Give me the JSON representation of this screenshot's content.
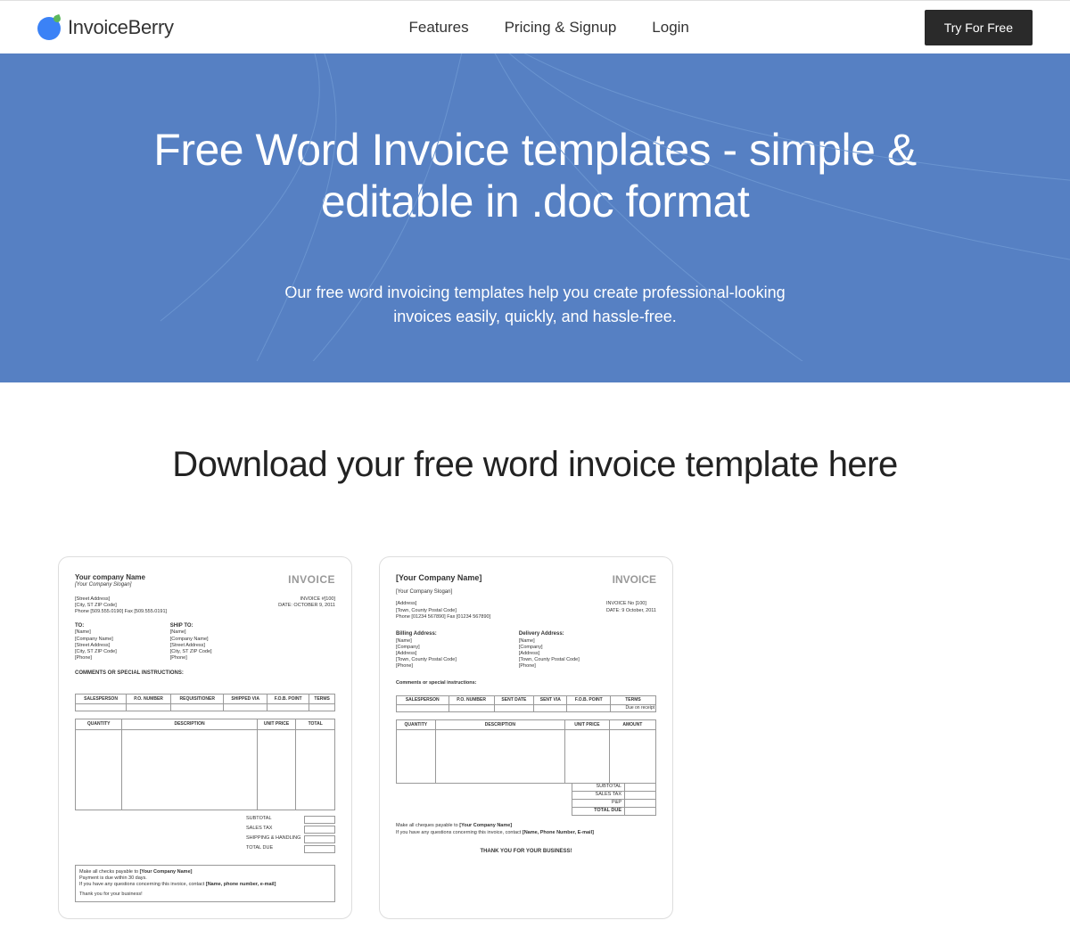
{
  "header": {
    "brand": "InvoiceBerry",
    "nav": [
      {
        "label": "Features"
      },
      {
        "label": "Pricing & Signup"
      },
      {
        "label": "Login"
      }
    ],
    "cta": "Try For Free"
  },
  "hero": {
    "title": "Free Word Invoice templates - simple & editable in .doc format",
    "subtitle": "Our free word invoicing templates help you create professional-looking invoices easily, quickly, and hassle-free."
  },
  "section": {
    "title": "Download your free word invoice template here"
  },
  "template1": {
    "company": "Your company Name",
    "slogan": "[Your Company Slogan]",
    "invoice_label": "INVOICE",
    "addr_line1": "[Street Address]",
    "addr_line2": "[City, ST  ZIP Code]",
    "addr_line3": "Phone [509.555.0190]  Fax [509.555.0191]",
    "meta_line1": "INVOICE #[100]",
    "meta_line2": "DATE: OCTOBER 9, 2011",
    "to_label": "TO:",
    "to_name": "[Name]",
    "to_company": "[Company Name]",
    "to_street": "[Street Address]",
    "to_city": "[City, ST  ZIP Code]",
    "to_phone": "[Phone]",
    "ship_label": "SHIP TO:",
    "ship_name": "[Name]",
    "ship_company": "[Company Name]",
    "ship_street": "[Street Address]",
    "ship_city": "[City, ST  ZIP Code]",
    "ship_phone": "[Phone]",
    "comments": "COMMENTS OR SPECIAL INSTRUCTIONS:",
    "t1_h1": "SALESPERSON",
    "t1_h2": "P.O. NUMBER",
    "t1_h3": "REQUISITIONER",
    "t1_h4": "SHIPPED VIA",
    "t1_h5": "F.O.B. POINT",
    "t1_h6": "TERMS",
    "t2_h1": "QUANTITY",
    "t2_h2": "DESCRIPTION",
    "t2_h3": "UNIT PRICE",
    "t2_h4": "TOTAL",
    "subtotal": "SUBTOTAL",
    "salestax": "SALES TAX",
    "shipping": "SHIPPING & HANDLING",
    "totaldue": "TOTAL DUE",
    "foot1": "Make all checks payable to [Your Company Name]",
    "foot2": "Payment is due within 30 days.",
    "foot3": "If you have any questions concerning this invoice, contact [Name, phone number, e-mail]",
    "foot4": "Thank you for your business!"
  },
  "template2": {
    "company": "[Your Company Name]",
    "slogan": "[Your Company Slogan]",
    "invoice_label": "INVOICE",
    "addr_line1": "[Address]",
    "addr_line2": "[Town, County  Postal Code]",
    "addr_line3": "Phone [01234 567890]  Fax [01234 567890]",
    "meta_line1": "INVOICE No [100]",
    "meta_line2": "DATE:  9 October, 2011",
    "bill_label": "Billing Address:",
    "bill_name": "[Name]",
    "bill_company": "[Company]",
    "bill_addr": "[Address]",
    "bill_city": "[Town, County  Postal Code]",
    "bill_phone": "[Phone]",
    "deliv_label": "Delivery Address:",
    "deliv_name": "[Name]",
    "deliv_company": "[Company]",
    "deliv_addr": "[Address]",
    "deliv_city": "[Town, County  Postal Code]",
    "deliv_phone": "[Phone]",
    "comments": "Comments or special instructions:",
    "t1_h1": "SALESPERSON",
    "t1_h2": "P.O. NUMBER",
    "t1_h3": "SENT DATE",
    "t1_h4": "SENT VIA",
    "t1_h5": "F.O.B. POINT",
    "t1_h6": "TERMS",
    "t1_due": "Due on receipt",
    "t2_h1": "QUANTITY",
    "t2_h2": "DESCRIPTION",
    "t2_h3": "UNIT PRICE",
    "t2_h4": "AMOUNT",
    "subtotal": "SUBTOTAL",
    "salestax": "SALES TAX",
    "pp": "P&P",
    "totaldue": "TOTAL DUE",
    "foot1": "Make all cheques payable to [Your Company Name]",
    "foot2": "If you have any questions concerning this invoice, contact [Name, Phone Number, E-mail]",
    "thanks": "THANK YOU FOR YOUR BUSINESS!"
  }
}
